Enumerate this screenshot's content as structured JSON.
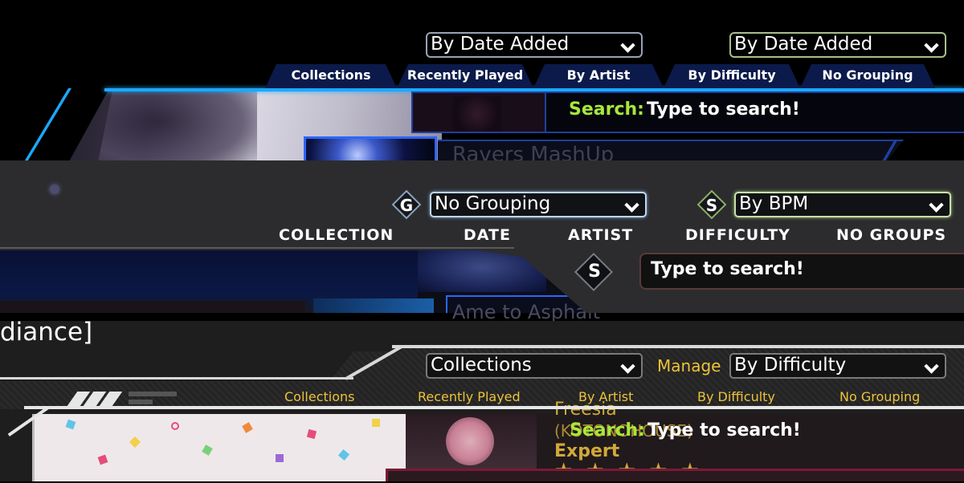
{
  "panel1": {
    "sort_dropdown_left": "By Date Added",
    "sort_dropdown_right": "By Date Added",
    "tabs": [
      "Collections",
      "Recently Played",
      "By Artist",
      "By Difficulty",
      "No Grouping"
    ],
    "search_label": "Search:",
    "search_placeholder": "Type to search!",
    "song_title": "Ravers MashUp",
    "accent_color": "#1aa9ff"
  },
  "panel2": {
    "group_badge": "G",
    "group_dropdown": "No Grouping",
    "sort_badge": "S",
    "sort_dropdown": "By BPM",
    "tabs": [
      "COLLECTION",
      "DATE",
      "ARTIST",
      "DIFFICULTY",
      "NO GROUPS"
    ],
    "search_badge": "S",
    "search_placeholder": "Type to search!",
    "song_title": "Ame to Asphalt"
  },
  "panel3": {
    "top_text": "diance]",
    "collection_dropdown": "Collections",
    "manage_label": "Manage",
    "sort_dropdown": "By Difficulty",
    "tabs": [
      "Collections",
      "Recently Played",
      "By Artist",
      "By Difficulty",
      "No Grouping"
    ],
    "search_label": "Search:",
    "search_placeholder": "Type to search!",
    "song_title": "Freesia",
    "song_artist": "(KOTONOHOUSE)",
    "difficulty": "Expert",
    "stars": "★★★★★",
    "accent_color": "#ecc33a"
  }
}
